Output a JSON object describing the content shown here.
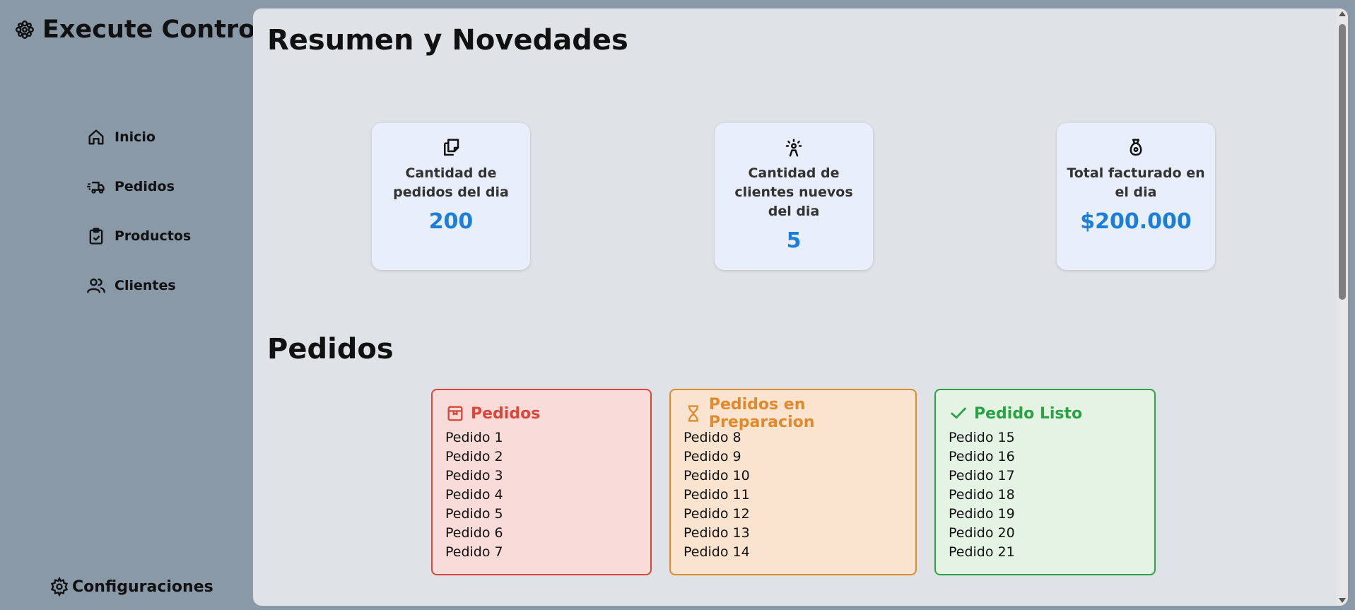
{
  "app": {
    "name": "Execute Control",
    "logo_icon": "flower-icon"
  },
  "sidebar": {
    "items": [
      {
        "label": "Inicio",
        "icon": "home-icon"
      },
      {
        "label": "Pedidos",
        "icon": "truck-icon"
      },
      {
        "label": "Productos",
        "icon": "clipboard-check-icon"
      },
      {
        "label": "Clientes",
        "icon": "users-icon"
      }
    ],
    "config_label": "Configuraciones",
    "config_icon": "gear-icon"
  },
  "summary": {
    "title": "Resumen y Novedades",
    "cards": [
      {
        "label": "Cantidad de pedidos del dia",
        "value": "200",
        "icon": "notes-icon"
      },
      {
        "label": "Cantidad de clientes nuevos del dia",
        "value": "5",
        "icon": "person-spark-icon"
      },
      {
        "label": "Total facturado en el dia",
        "value": "$200.000",
        "icon": "money-bag-icon"
      }
    ]
  },
  "orders": {
    "title": "Pedidos",
    "columns": [
      {
        "title": "Pedidos",
        "icon": "box-icon",
        "color": "#d9473a",
        "items": [
          "Pedido 1",
          "Pedido 2",
          "Pedido 3",
          "Pedido 4",
          "Pedido 5",
          "Pedido 6",
          "Pedido 7"
        ]
      },
      {
        "title": "Pedidos en Preparacion",
        "icon": "hourglass-icon",
        "color": "#e08a2e",
        "items": [
          "Pedido 8",
          "Pedido 9",
          "Pedido 10",
          "Pedido 11",
          "Pedido 12",
          "Pedido 13",
          "Pedido 14"
        ]
      },
      {
        "title": "Pedido Listo",
        "icon": "check-icon",
        "color": "#2aa345",
        "items": [
          "Pedido 15",
          "Pedido 16",
          "Pedido 17",
          "Pedido 18",
          "Pedido 19",
          "Pedido 20",
          "Pedido 21"
        ]
      }
    ]
  },
  "colors": {
    "accent": "#1b7ed8",
    "sidebar_bg": "#8a99a8",
    "main_bg": "#dfe2e7"
  }
}
